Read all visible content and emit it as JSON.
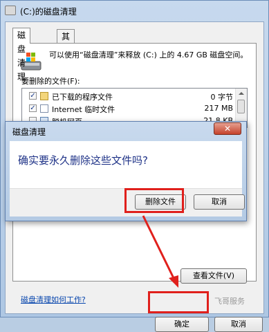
{
  "window": {
    "title": "(C:)的磁盘清理"
  },
  "tabs": [
    {
      "label": "磁盘清理",
      "active": true
    },
    {
      "label": "其他选项",
      "active": false
    }
  ],
  "description": "可以使用“磁盘清理”来释放 (C:) 上的 4.67 GB 磁盘空间。",
  "files_label": "要删除的文件(F):",
  "files": [
    {
      "checked": true,
      "icon": "folder-icon",
      "name": "已下载的程序文件",
      "size": "0 字节"
    },
    {
      "checked": true,
      "icon": "document-icon",
      "name": "Internet 临时文件",
      "size": "217 MB"
    },
    {
      "checked": false,
      "icon": "webpage-icon",
      "name": "脱机网页",
      "size": "21.8 KB"
    }
  ],
  "view_files_button": "查看文件(V)",
  "help_link": "磁盘清理如何工作?",
  "ok_button": "确定",
  "cancel_button": "取消",
  "watermark": "飞哥服务",
  "dialog": {
    "title": "磁盘清理",
    "close_glyph": "✕",
    "message": "确实要永久删除这些文件吗?",
    "delete_button": "删除文件",
    "cancel_button": "取消"
  },
  "colors": {
    "highlight": "#e0201c",
    "message_text": "#1e3287"
  }
}
